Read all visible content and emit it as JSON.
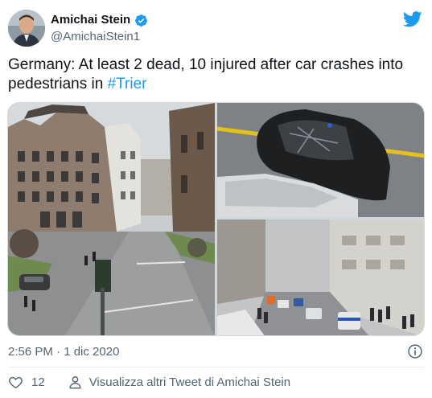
{
  "tweet": {
    "author_name": "Amichai Stein",
    "author_handle": "@AmichaiStein1",
    "verified": true,
    "text_main": "Germany: At least 2 dead, 10 injured after car crashes into pedestrians in ",
    "hashtag": "#Trier",
    "timestamp": "2:56 PM · 1 dic 2020",
    "like_count": "12",
    "more_tweets_label": "Visualizza altri Tweet di Amichai Stein"
  },
  "icons": {
    "brand": "twitter-bird-icon",
    "verified": "verified-badge-icon",
    "info": "info-icon",
    "like": "heart-icon",
    "more": "person-icon"
  },
  "colors": {
    "accent": "#1d9bf0",
    "text": "#0f1419",
    "muted": "#536471"
  },
  "media": {
    "photos": [
      "street-intersection-photo",
      "crashed-car-photo",
      "shopping-street-police-photo"
    ]
  }
}
